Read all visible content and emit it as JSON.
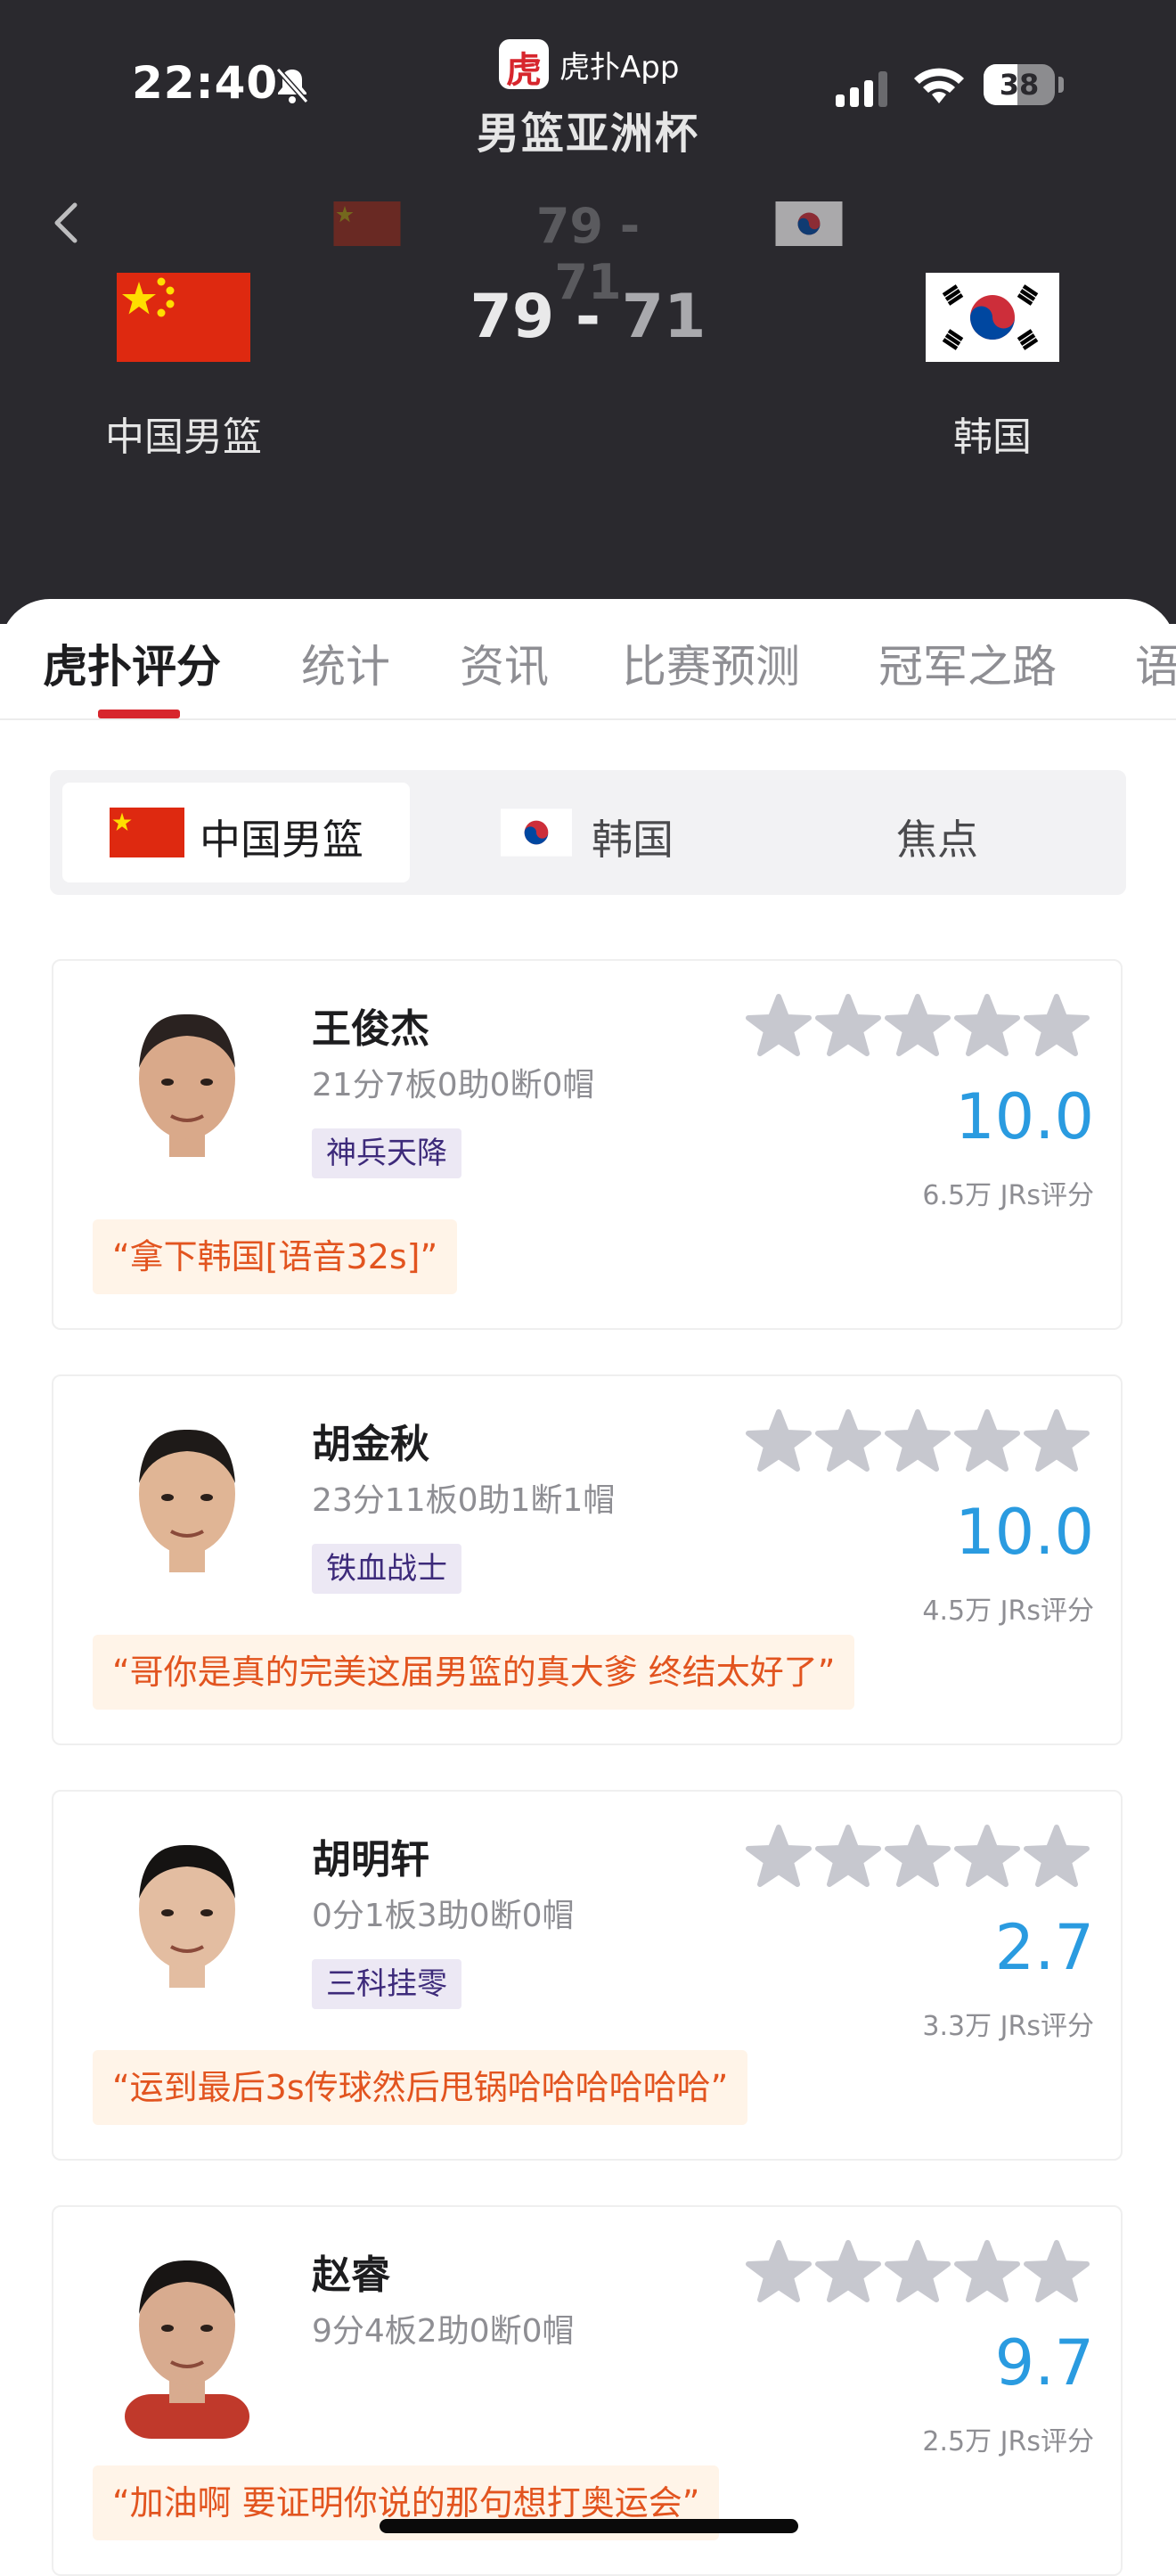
{
  "status_bar": {
    "time": "22:40",
    "battery": "38"
  },
  "app": {
    "name": "虎扑App",
    "badge_glyph": "虎"
  },
  "match": {
    "title": "男篮亚洲杯",
    "home_team": "中国男篮",
    "away_team": "韩国",
    "home_score": "79",
    "away_score": "71",
    "separator": "-",
    "mini_score": "79 - 71"
  },
  "tabs": [
    {
      "label": "虎扑评分",
      "active": true
    },
    {
      "label": "统计"
    },
    {
      "label": "资讯"
    },
    {
      "label": "比赛预测"
    },
    {
      "label": "冠军之路"
    },
    {
      "label": "语"
    }
  ],
  "segments": [
    {
      "label": "中国男篮",
      "active": true
    },
    {
      "label": "韩国"
    },
    {
      "label": "焦点"
    }
  ],
  "players": [
    {
      "name": "王俊杰",
      "stats": "21分7板0助0断0帽",
      "tag": "神兵天降",
      "score": "10.0",
      "votes": "6.5万 JRs评分",
      "stars_filled": 0,
      "quote": "“拿下韩国[语音32s]”"
    },
    {
      "name": "胡金秋",
      "stats": "23分11板0助1断1帽",
      "tag": "铁血战士",
      "score": "10.0",
      "votes": "4.5万 JRs评分",
      "stars_filled": 0,
      "quote": "“哥你是真的完美这届男篮的真大爹 终结太好了”"
    },
    {
      "name": "胡明轩",
      "stats": "0分1板3助0断0帽",
      "tag": "三科挂零",
      "score": "2.7",
      "votes": "3.3万 JRs评分",
      "stars_filled": 0,
      "quote": "“运到最后3s传球然后甩锅哈哈哈哈哈哈”"
    },
    {
      "name": "赵睿",
      "stats": "9分4板2助0断0帽",
      "tag": "",
      "score": "9.7",
      "votes": "2.5万 JRs评分",
      "stars_filled": 0,
      "quote": "“加油啊 要证明你说的那句想打奥运会”"
    }
  ],
  "colors": {
    "header_bg": "#2a292e",
    "accent_red": "#d7262d",
    "score_blue": "#2a9be0",
    "quote_orange": "#e2541f",
    "tag_purple": "#3d2a7a",
    "star_gray": "#c7c8cf"
  },
  "icons": [
    "bell-muted-icon",
    "signal-icon",
    "wifi-icon",
    "battery-icon",
    "back-chevron-icon",
    "star-icon"
  ]
}
